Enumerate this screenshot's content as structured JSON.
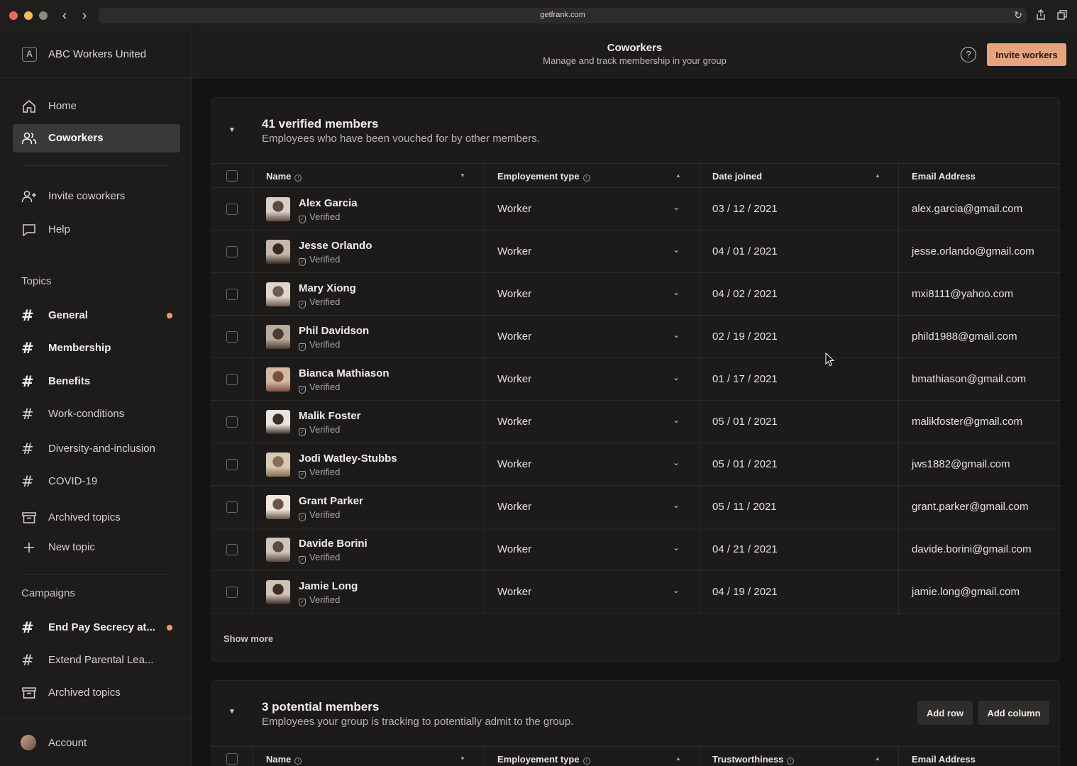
{
  "browser": {
    "url": "getfrank.com"
  },
  "workspace": {
    "badge": "A",
    "name": "ABC Workers United"
  },
  "sidebar": {
    "nav": [
      {
        "label": "Home",
        "icon": "home-icon"
      },
      {
        "label": "Coworkers",
        "icon": "users-icon",
        "active": true
      }
    ],
    "secondary": [
      {
        "label": "Invite coworkers",
        "icon": "user-plus-icon"
      },
      {
        "label": "Help",
        "icon": "chat-bubble-icon"
      }
    ],
    "topics_heading": "Topics",
    "topics": [
      {
        "label": "General",
        "bold": true,
        "unread": true
      },
      {
        "label": "Membership",
        "bold": true,
        "unread": false
      },
      {
        "label": "Benefits",
        "bold": true,
        "unread": false
      },
      {
        "label": "Work-conditions",
        "bold": false,
        "unread": false
      },
      {
        "label": "Diversity-and-inclusion",
        "bold": false,
        "unread": false
      },
      {
        "label": "COVID-19",
        "bold": false,
        "unread": false
      }
    ],
    "topics_archived": "Archived topics",
    "new_topic": "New topic",
    "campaigns_heading": "Campaigns",
    "campaigns": [
      {
        "label": "End Pay Secrecy at...",
        "bold": true,
        "unread": true
      },
      {
        "label": "Extend Parental Lea...",
        "bold": false,
        "unread": false
      }
    ],
    "campaigns_archived": "Archived topics",
    "account": "Account"
  },
  "header": {
    "title": "Coworkers",
    "subtitle": "Manage and track membership in your group",
    "invite_label": "Invite workers"
  },
  "verified": {
    "title": "41 verified members",
    "subtitle": "Employees who have been vouched for by other members.",
    "columns": {
      "name": "Name",
      "type": "Employement type",
      "date": "Date joined",
      "email": "Email Address"
    },
    "verified_label": "Verified",
    "rows": [
      {
        "name": "Alex Garcia",
        "type": "Worker",
        "date": "03 / 12 / 2021",
        "email": "alex.garcia@gmail.com"
      },
      {
        "name": "Jesse Orlando",
        "type": "Worker",
        "date": "04 / 01 / 2021",
        "email": "jesse.orlando@gmail.com"
      },
      {
        "name": "Mary Xiong",
        "type": "Worker",
        "date": "04 / 02 / 2021",
        "email": "mxi8111@yahoo.com"
      },
      {
        "name": "Phil Davidson",
        "type": "Worker",
        "date": "02 / 19 / 2021",
        "email": "phild1988@gmail.com"
      },
      {
        "name": "Bianca Mathiason",
        "type": "Worker",
        "date": "01 / 17 / 2021",
        "email": "bmathiason@gmail.com"
      },
      {
        "name": "Malik Foster",
        "type": "Worker",
        "date": "05 / 01 / 2021",
        "email": "malikfoster@gmail.com"
      },
      {
        "name": "Jodi Watley-Stubbs",
        "type": "Worker",
        "date": "05 / 01 / 2021",
        "email": "jws1882@gmail.com"
      },
      {
        "name": "Grant Parker",
        "type": "Worker",
        "date": "05 / 11 / 2021",
        "email": "grant.parker@gmail.com"
      },
      {
        "name": "Davide Borini",
        "type": "Worker",
        "date": "04 / 21 / 2021",
        "email": "davide.borini@gmail.com"
      },
      {
        "name": "Jamie Long",
        "type": "Worker",
        "date": "04 / 19 / 2021",
        "email": "jamie.long@gmail.com"
      }
    ],
    "show_more": "Show more"
  },
  "potential": {
    "title": "3 potential members",
    "subtitle": "Employees your group is tracking to potentially admit to the group.",
    "add_row": "Add row",
    "add_column": "Add column",
    "columns": {
      "name": "Name",
      "type": "Employement type",
      "trust": "Trustworthiness",
      "email": "Email Address"
    }
  },
  "colors": {
    "accent": "#e6a37e",
    "unread_dot": "#e89a76",
    "background": "#141312",
    "sidebar": "#1d1c1b"
  }
}
